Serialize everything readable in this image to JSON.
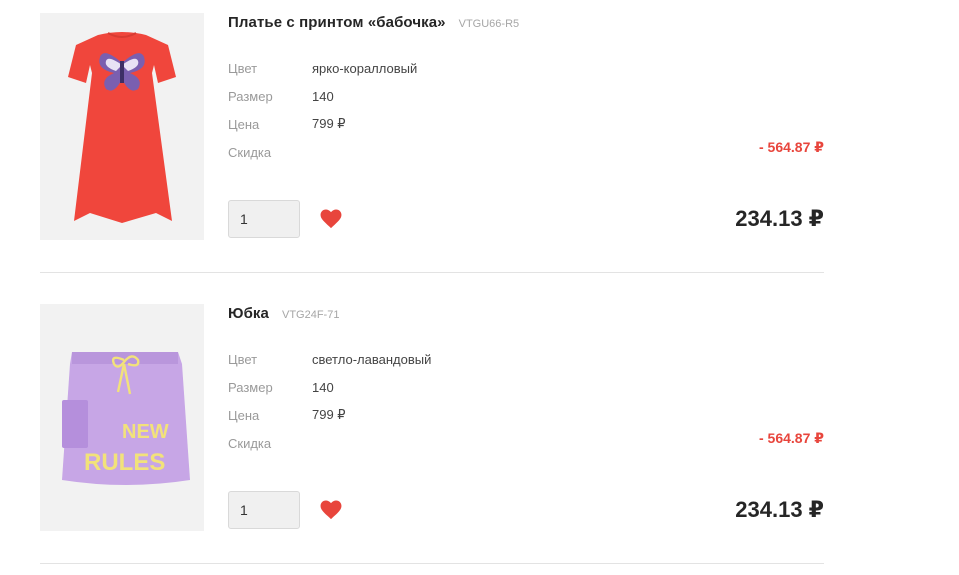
{
  "cart": {
    "items": [
      {
        "title": "Платье с принтом «бабочка»",
        "sku": "VTGU66-R5",
        "props": [
          {
            "label": "Цвет",
            "value": "ярко-коралловый"
          },
          {
            "label": "Размер",
            "value": "140"
          },
          {
            "label": "Цена",
            "value": "799 ₽"
          },
          {
            "label": "Скидка",
            "value": ""
          }
        ],
        "discount": "- 564.87 ₽",
        "quantity": "1",
        "total": "234.13 ₽",
        "favorite_icon": "heart-icon",
        "image_subject": "coral-dress"
      },
      {
        "title": "Юбка",
        "sku": "VTG24F-71",
        "props": [
          {
            "label": "Цвет",
            "value": "светло-лавандовый"
          },
          {
            "label": "Размер",
            "value": "140"
          },
          {
            "label": "Цена",
            "value": "799 ₽"
          },
          {
            "label": "Скидка",
            "value": ""
          }
        ],
        "discount": "- 564.87 ₽",
        "quantity": "1",
        "total": "234.13 ₽",
        "favorite_icon": "heart-icon",
        "image_subject": "lavender-skirt",
        "image_print_text": [
          "NEW",
          "RULES"
        ]
      }
    ]
  },
  "colors": {
    "accent_red": "#e8453c",
    "dress": "#f0463c",
    "skirt": "#c7a6e6",
    "skirt_print": "#f2e27a"
  }
}
